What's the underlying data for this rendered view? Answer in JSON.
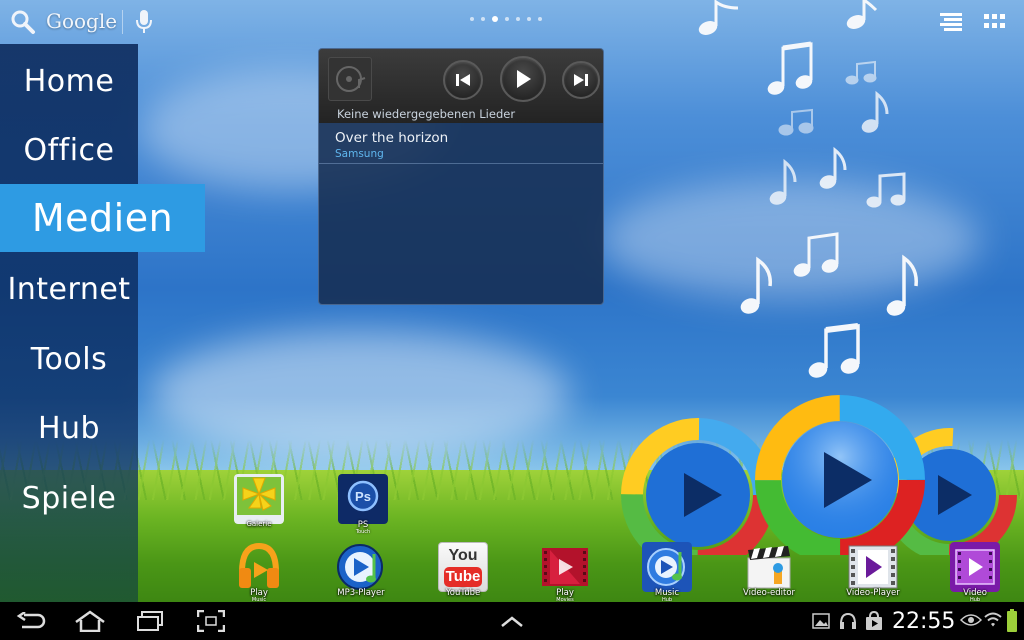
{
  "top_bar": {
    "search_label": "Google",
    "page_count": 7,
    "active_page": 3
  },
  "sidebar": {
    "items": [
      {
        "label": "Home"
      },
      {
        "label": "Office"
      },
      {
        "label": "Medien",
        "selected": true
      },
      {
        "label": "Internet"
      },
      {
        "label": "Tools"
      },
      {
        "label": "Hub"
      },
      {
        "label": "Spiele"
      }
    ]
  },
  "music_widget": {
    "status_text": "Keine wiedergegebenen Lieder",
    "song": {
      "title": "Over the horizon",
      "artist": "Samsung"
    }
  },
  "apps": {
    "galerie": {
      "label": "Galerie"
    },
    "ps": {
      "label": "PS",
      "sub": "Touch"
    },
    "play_music": {
      "label": "Play",
      "sub": "Music"
    },
    "mp3_player": {
      "label": "MP3-Player"
    },
    "youtube": {
      "label": "YouTube",
      "icon_text_top": "You",
      "icon_text_bottom": "Tube"
    },
    "play_movies": {
      "label": "Play",
      "sub": "Movies"
    },
    "music_hub": {
      "label": "Music",
      "sub": "Hub"
    },
    "video_editor": {
      "label": "Video-editor"
    },
    "video_player": {
      "label": "Video-Player"
    },
    "video_hub": {
      "label": "Video",
      "sub": "Hub"
    }
  },
  "nav_bar": {
    "clock": "22:55"
  },
  "colors": {
    "accent": "#2e9be3",
    "artist_text": "#5fb6ee"
  }
}
